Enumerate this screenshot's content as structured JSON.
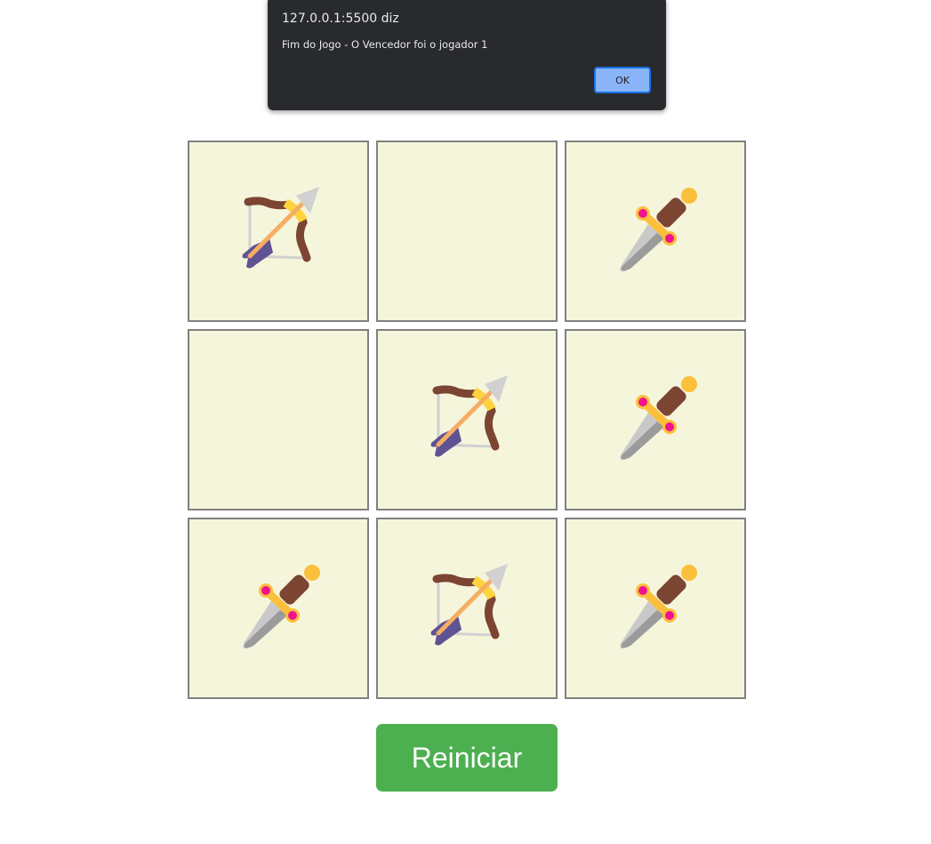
{
  "alert": {
    "origin": "127.0.0.1:5500 diz",
    "message": "Fim do Jogo - O Vencedor foi o jogador 1",
    "ok_label": "OK"
  },
  "board": {
    "cells": [
      "bow-and-arrow",
      "",
      "dagger",
      "",
      "bow-and-arrow",
      "dagger",
      "dagger",
      "bow-and-arrow",
      "dagger"
    ]
  },
  "restart_label": "Reiniciar",
  "colors": {
    "cell_bg": "#f5f5dc",
    "button": "#4caf50",
    "dialog_bg": "#292a2d",
    "ok_button": "#8ab4f8"
  }
}
